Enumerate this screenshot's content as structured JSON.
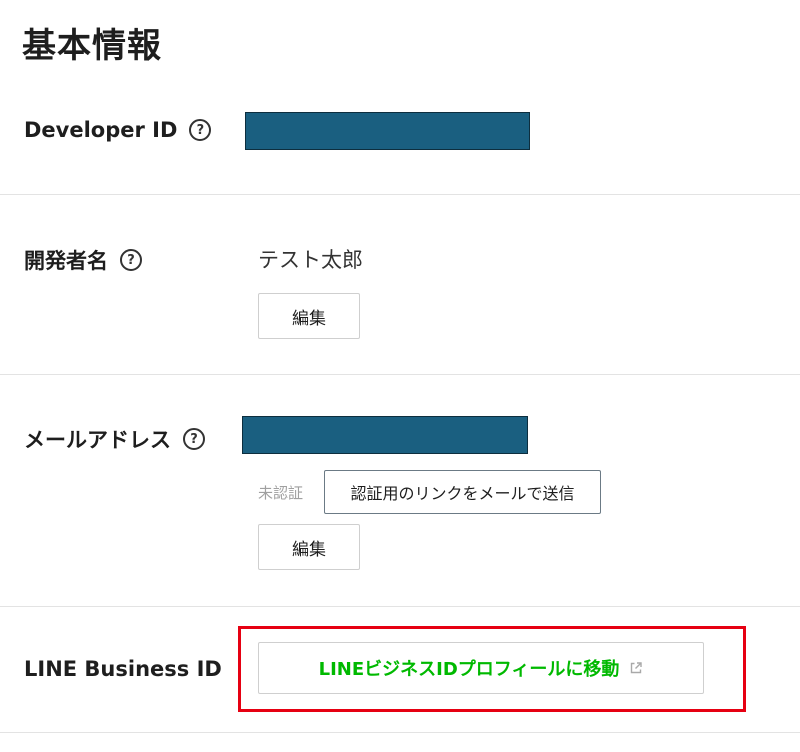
{
  "page": {
    "title": "基本情報"
  },
  "developer_id": {
    "label": "Developer ID",
    "help": "?"
  },
  "developer_name": {
    "label": "開発者名",
    "help": "?",
    "value": "テスト太郎",
    "edit_button": "編集"
  },
  "email": {
    "label": "メールアドレス",
    "help": "?",
    "status": "未認証",
    "verify_button": "認証用のリンクをメールで送信",
    "edit_button": "編集"
  },
  "line_business_id": {
    "label": "LINE Business ID",
    "link_button": "LINEビジネスIDプロフィールに移動"
  },
  "colors": {
    "accent_green": "#00b900",
    "redaction": "#1a5f80",
    "highlight_red": "#e60012"
  },
  "icons": {
    "help": "help-circle-icon",
    "external_link": "external-link-icon"
  }
}
